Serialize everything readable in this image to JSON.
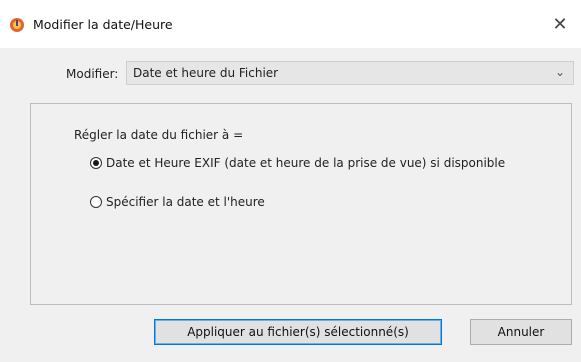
{
  "window": {
    "title": "Modifier la date/Heure",
    "close_glyph": "✕",
    "app_icon": "app-icon-orange-gear"
  },
  "modifier": {
    "label": "Modifier:",
    "selected": "Date et heure du Fichier",
    "arrow_glyph": "⌄"
  },
  "group": {
    "title": "Régler la date du fichier à =",
    "options": [
      {
        "label": "Date et Heure EXIF (date et heure de la prise de vue) si disponible",
        "selected": true
      },
      {
        "label": "Spécifier la date et l'heure",
        "selected": false
      }
    ]
  },
  "buttons": {
    "apply": "Appliquer au fichier(s) sélectionné(s)",
    "cancel": "Annuler"
  },
  "colors": {
    "background": "#f0f0f0",
    "titlebar": "#ffffff",
    "primary_border": "#0078d7"
  }
}
